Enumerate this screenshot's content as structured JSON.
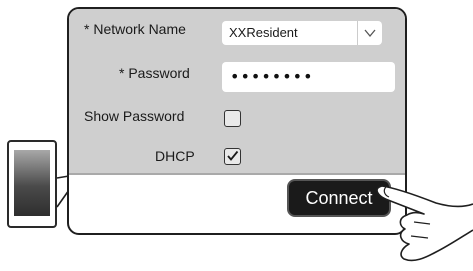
{
  "form": {
    "network_name_label": "* Network Name",
    "network_name_value": "XXResident",
    "password_label": "* Password",
    "password_value": "••••••••",
    "show_password_label": "Show Password",
    "show_password_checked": false,
    "dhcp_label": "DHCP",
    "dhcp_checked": true
  },
  "actions": {
    "connect_label": "Connect"
  },
  "icons": {
    "dropdown": "chevron-down-icon",
    "check": "checkmark-icon",
    "phone": "smartphone-icon",
    "hand": "pointing-hand-icon"
  },
  "colors": {
    "panel": "#cfcfcf",
    "button": "#1a1a1a",
    "button_text": "#ffffff"
  }
}
